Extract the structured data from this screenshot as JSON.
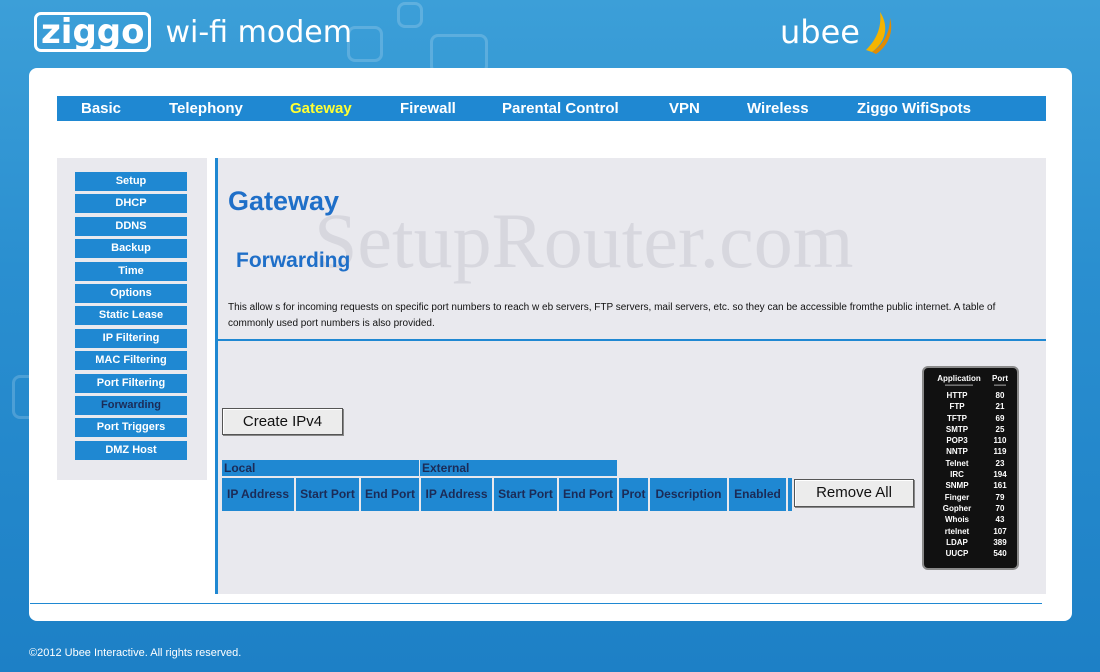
{
  "brand": {
    "logo": "ziggo",
    "product": "wi-fi modem",
    "partner": "ubee"
  },
  "topnav": [
    {
      "label": "Basic",
      "active": false
    },
    {
      "label": "Telephony",
      "active": false
    },
    {
      "label": "Gateway",
      "active": true
    },
    {
      "label": "Firewall",
      "active": false
    },
    {
      "label": "Parental Control",
      "active": false
    },
    {
      "label": "VPN",
      "active": false
    },
    {
      "label": "Wireless",
      "active": false
    },
    {
      "label": "Ziggo WifiSpots",
      "active": false
    }
  ],
  "sidebar": [
    {
      "label": "Setup",
      "active": false
    },
    {
      "label": "DHCP",
      "active": false
    },
    {
      "label": "DDNS",
      "active": false
    },
    {
      "label": "Backup",
      "active": false
    },
    {
      "label": "Time",
      "active": false
    },
    {
      "label": "Options",
      "active": false
    },
    {
      "label": "Static Lease",
      "active": false
    },
    {
      "label": "IP Filtering",
      "active": false
    },
    {
      "label": "MAC Filtering",
      "active": false
    },
    {
      "label": "Port Filtering",
      "active": false
    },
    {
      "label": "Forwarding",
      "active": true
    },
    {
      "label": "Port Triggers",
      "active": false
    },
    {
      "label": "DMZ Host",
      "active": false
    }
  ],
  "main": {
    "title": "Gateway",
    "subtitle": "Forwarding",
    "description": "This allow s for incoming requests on specific port numbers to reach w eb servers, FTP servers, mail servers, etc. so they can be accessible fromthe public internet. A table of commonly used port numbers is also provided.",
    "watermark": "SetupRouter.com",
    "create_button": "Create IPv4",
    "remove_button": "Remove All"
  },
  "table": {
    "groups": [
      "Local",
      "External"
    ],
    "columns": [
      "IP Address",
      "Start Port",
      "End Port",
      "IP Address",
      "Start Port",
      "End Port",
      "Prot",
      "Description",
      "Enabled"
    ]
  },
  "port_reference": {
    "headers": [
      "Application",
      "Port"
    ],
    "separator": [
      "--------------",
      "------"
    ],
    "rows": [
      [
        "HTTP",
        "80"
      ],
      [
        "FTP",
        "21"
      ],
      [
        "TFTP",
        "69"
      ],
      [
        "SMTP",
        "25"
      ],
      [
        "POP3",
        "110"
      ],
      [
        "NNTP",
        "119"
      ],
      [
        "Telnet",
        "23"
      ],
      [
        "IRC",
        "194"
      ],
      [
        "SNMP",
        "161"
      ],
      [
        "Finger",
        "79"
      ],
      [
        "Gopher",
        "70"
      ],
      [
        "Whois",
        "43"
      ],
      [
        "rtelnet",
        "107"
      ],
      [
        "LDAP",
        "389"
      ],
      [
        "UUCP",
        "540"
      ]
    ]
  },
  "footer": {
    "copyright": "©2012 Ubee Interactive. All rights reserved."
  },
  "colors": {
    "nav_blue": "#1f88d2",
    "active_nav": "#ffff33",
    "title_blue": "#1f6fc8"
  }
}
